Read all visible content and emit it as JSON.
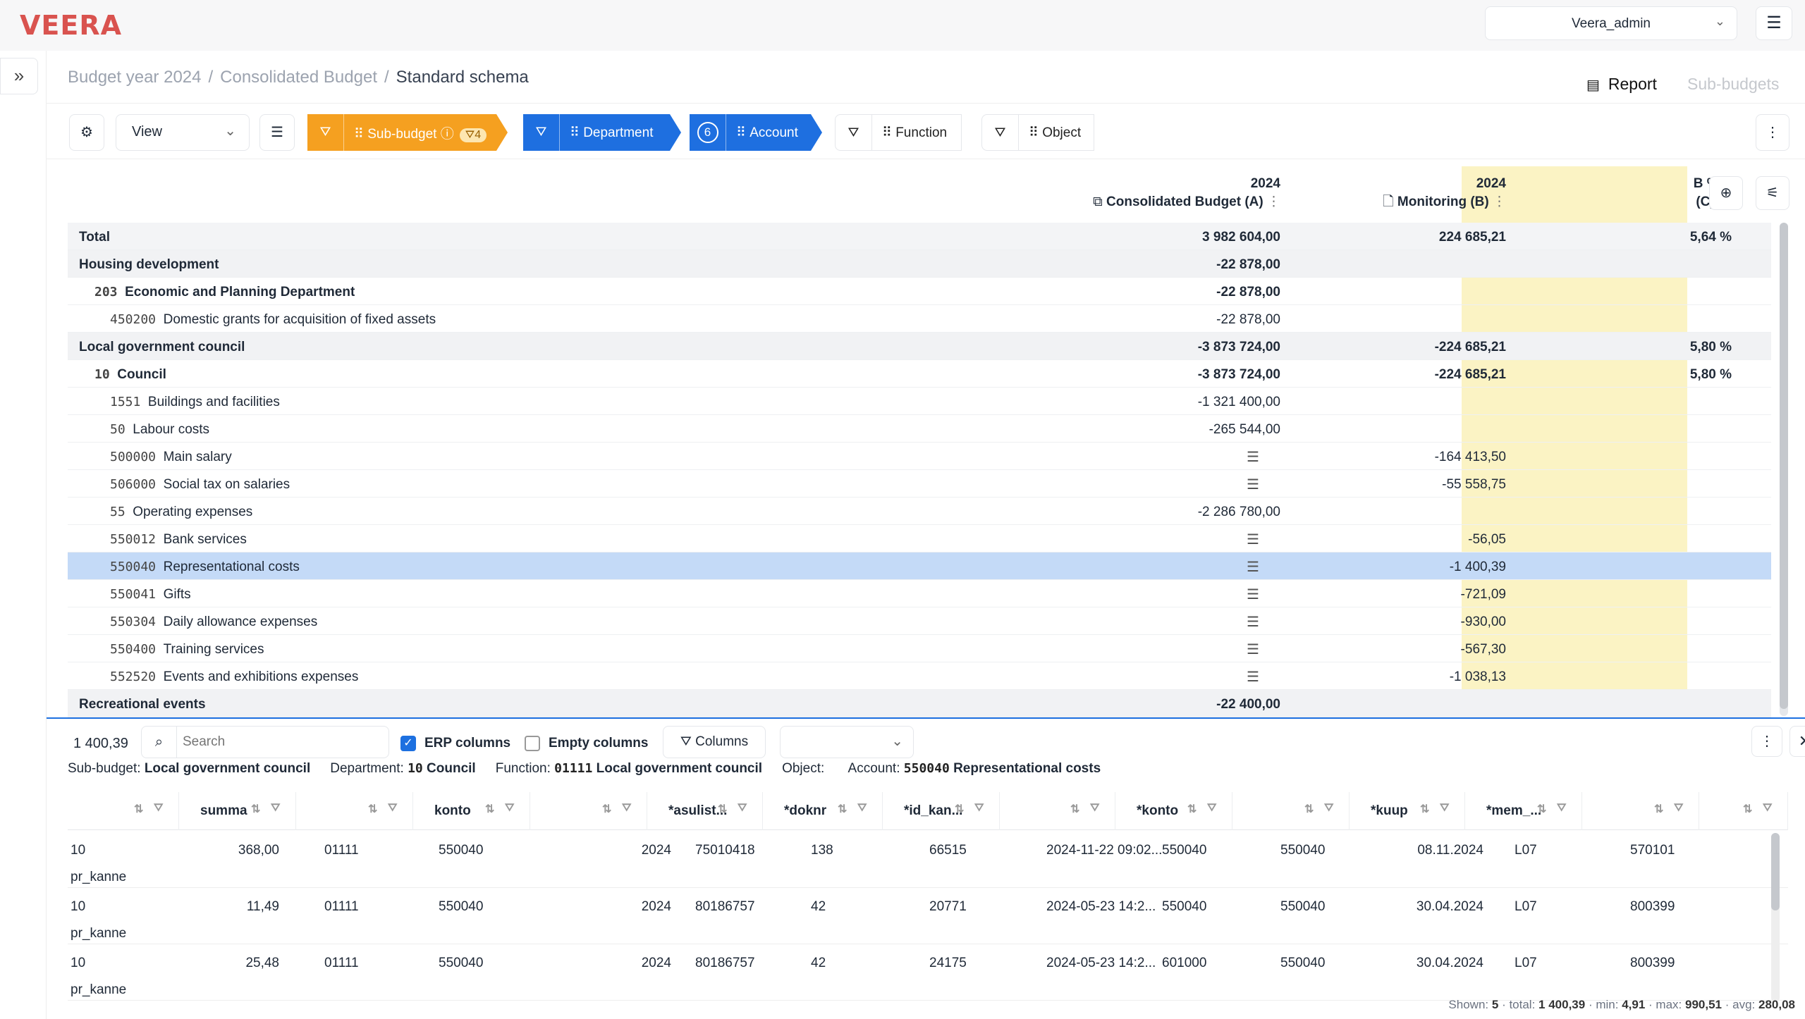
{
  "app": {
    "logo": "VEERA",
    "user": "Veera_admin"
  },
  "breadcrumb": [
    "Budget year 2024",
    "Consolidated Budget",
    "Standard schema"
  ],
  "view_tabs": [
    "Report",
    "Sub-budgets"
  ],
  "toolbar": {
    "view_label": "View",
    "dims": [
      {
        "label": "Sub-budget",
        "badge": "4",
        "style": "orange"
      },
      {
        "label": "Department",
        "style": "blue"
      },
      {
        "label": "Account",
        "count": "6",
        "style": "blue"
      },
      {
        "label": "Function",
        "style": "plain"
      },
      {
        "label": "Object",
        "style": "plain"
      }
    ]
  },
  "columns": [
    {
      "year": "2024",
      "name": "Consolidated Budget (A)"
    },
    {
      "year": "2024",
      "name": "Monitoring (B)"
    },
    {
      "year": "B % A",
      "name": "(C)"
    }
  ],
  "rows": [
    {
      "code": "",
      "label": "Total",
      "a": "3 982 604,00",
      "b": "224 685,21",
      "c": "5,64 %",
      "type": "total",
      "indent": 0
    },
    {
      "code": "",
      "label": "Housing development",
      "a": "-22 878,00",
      "b": "",
      "c": "",
      "type": "grp",
      "indent": 0
    },
    {
      "code": "203",
      "label": "Economic and Planning Department",
      "a": "-22 878,00",
      "b": "",
      "c": "",
      "type": "bold",
      "indent": 1
    },
    {
      "code": "450200",
      "label": "Domestic grants for acquisition of fixed assets",
      "a": "-22 878,00",
      "b": "",
      "c": "",
      "type": "",
      "indent": 2
    },
    {
      "code": "",
      "label": "Local government council",
      "a": "-3 873 724,00",
      "b": "-224 685,21",
      "c": "5,80 %",
      "type": "grp",
      "indent": 0
    },
    {
      "code": "10",
      "label": "Council",
      "a": "-3 873 724,00",
      "b": "-224 685,21",
      "c": "5,80 %",
      "type": "bold",
      "indent": 1
    },
    {
      "code": "1551",
      "label": "Buildings and facilities",
      "a": "-1 321 400,00",
      "b": "",
      "c": "",
      "type": "",
      "indent": 2
    },
    {
      "code": "50",
      "label": "Labour costs",
      "a": "-265 544,00",
      "b": "",
      "c": "",
      "type": "",
      "indent": 2
    },
    {
      "code": "500000",
      "label": "Main salary",
      "a": "",
      "b": "-164 413,50",
      "c": "",
      "type": "",
      "indent": 2,
      "icon": true
    },
    {
      "code": "506000",
      "label": "Social tax on salaries",
      "a": "",
      "b": "-55 558,75",
      "c": "",
      "type": "",
      "indent": 2,
      "icon": true
    },
    {
      "code": "55",
      "label": "Operating expenses",
      "a": "-2 286 780,00",
      "b": "",
      "c": "",
      "type": "",
      "indent": 2
    },
    {
      "code": "550012",
      "label": "Bank services",
      "a": "",
      "b": "-56,05",
      "c": "",
      "type": "",
      "indent": 2,
      "icon": true
    },
    {
      "code": "550040",
      "label": "Representational costs",
      "a": "",
      "b": "-1 400,39",
      "c": "",
      "type": "sel",
      "indent": 2,
      "icon": true
    },
    {
      "code": "550041",
      "label": "Gifts",
      "a": "",
      "b": "-721,09",
      "c": "",
      "type": "",
      "indent": 2,
      "icon": true
    },
    {
      "code": "550304",
      "label": "Daily allowance expenses",
      "a": "",
      "b": "-930,00",
      "c": "",
      "type": "",
      "indent": 2,
      "icon": true
    },
    {
      "code": "550400",
      "label": "Training services",
      "a": "",
      "b": "-567,30",
      "c": "",
      "type": "",
      "indent": 2,
      "icon": true
    },
    {
      "code": "552520",
      "label": "Events and exhibitions expenses",
      "a": "",
      "b": "-1 038,13",
      "c": "",
      "type": "",
      "indent": 2,
      "icon": true
    },
    {
      "code": "",
      "label": "Recreational events",
      "a": "-22 400,00",
      "b": "",
      "c": "",
      "type": "grp",
      "indent": 0
    }
  ],
  "detail": {
    "value": "1 400,39",
    "search_placeholder": "Search",
    "erp_label": "ERP columns",
    "empty_label": "Empty columns",
    "columns_btn": "Columns",
    "context": [
      {
        "k": "Sub-budget:",
        "v": "Local government council",
        "code": ""
      },
      {
        "k": "Department:",
        "v": "Council",
        "code": "10"
      },
      {
        "k": "Function:",
        "v": "Local government council",
        "code": "01111"
      },
      {
        "k": "Object:",
        "v": "",
        "code": ""
      },
      {
        "k": "Account:",
        "v": "Representational costs",
        "code": "550040"
      }
    ],
    "headers": [
      "",
      "summa",
      "",
      "konto",
      "",
      "*asulist...",
      "*doknr",
      "*id_kan...",
      "",
      "*konto",
      "",
      "*kuup",
      "*mem_...",
      "",
      ""
    ],
    "rows": [
      {
        "c": [
          "10",
          "368,00",
          "01111",
          "550040",
          "2024",
          "75010418",
          "138",
          "66515",
          "2024-11-22 09:02...",
          "550040",
          "550040",
          "08.11.2024",
          "L07",
          "570101"
        ],
        "sub": "pr_kanne"
      },
      {
        "c": [
          "10",
          "11,49",
          "01111",
          "550040",
          "2024",
          "80186757",
          "42",
          "20771",
          "2024-05-23 14:2...",
          "550040",
          "550040",
          "30.04.2024",
          "L07",
          "800399"
        ],
        "sub": "pr_kanne"
      },
      {
        "c": [
          "10",
          "25,48",
          "01111",
          "550040",
          "2024",
          "80186757",
          "42",
          "24175",
          "2024-05-23 14:2...",
          "601000",
          "550040",
          "30.04.2024",
          "L07",
          "800399"
        ],
        "sub": "pr_kanne"
      }
    ],
    "stats": {
      "shown_label": "Shown:",
      "shown": "5",
      "total_label": "· total:",
      "total": "1 400,39",
      "min_label": "· min:",
      "min": "4,91",
      "max_label": "· max:",
      "max": "990,51",
      "avg_label": "· avg:",
      "avg": "280,08"
    }
  }
}
